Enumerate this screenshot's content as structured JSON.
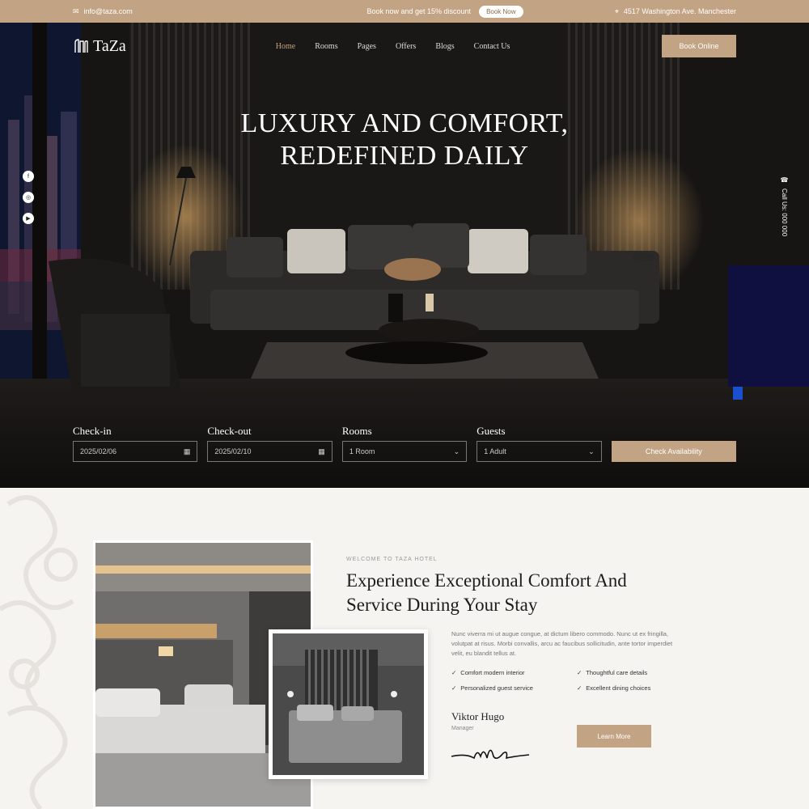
{
  "topbar": {
    "email": "info@taza.com",
    "promo_text": "Book now and get 15% discount",
    "promo_button": "Book Now",
    "address": "4517 Washington Ave. Manchester"
  },
  "brand": {
    "logo": "TaZa"
  },
  "nav": {
    "items": [
      "Home",
      "Rooms",
      "Pages",
      "Offers",
      "Blogs",
      "Contact Us"
    ],
    "cta": "Book Online"
  },
  "hero": {
    "headline_line1": "LUXURY AND COMFORT,",
    "headline_line2": "REDEFINED DAILY",
    "call_text": "Call Us: 000 000"
  },
  "booking": {
    "checkin_label": "Check-in",
    "checkin_value": "2025/02/06",
    "checkout_label": "Check-out",
    "checkout_value": "2025/02/10",
    "rooms_label": "Rooms",
    "rooms_value": "1 Room",
    "guests_label": "Guests",
    "guests_value": "1 Adult",
    "button": "Check Availability"
  },
  "about": {
    "eyebrow": "WELCOME TO TAZA HOTEL",
    "title": "Experience Exceptional Comfort And Service During Your Stay",
    "description": "Nunc viverra mi ut augue congue, at dictum libero commodo. Nunc ut ex fringilla, volutpat at risus. Morbi convallis, arcu ac faucibus sollicitudin, ante tortor imperdiet velit, eu blandit tellus at.",
    "features": [
      "Comfort modern interior",
      "Personalized guest service",
      "Thoughtful care details",
      "Excellent dining choices"
    ],
    "signer_name": "Viktor Hugo",
    "signer_role": "Manager",
    "button": "Learn More"
  },
  "icons": {
    "email": "mail-icon",
    "location": "pin-icon",
    "calendar": "calendar-icon",
    "chevron": "chevron-down-icon",
    "phone": "phone-icon"
  },
  "colors": {
    "accent": "#c2a383",
    "hero_bg": "#141211",
    "section_bg": "#f6f4f1"
  }
}
